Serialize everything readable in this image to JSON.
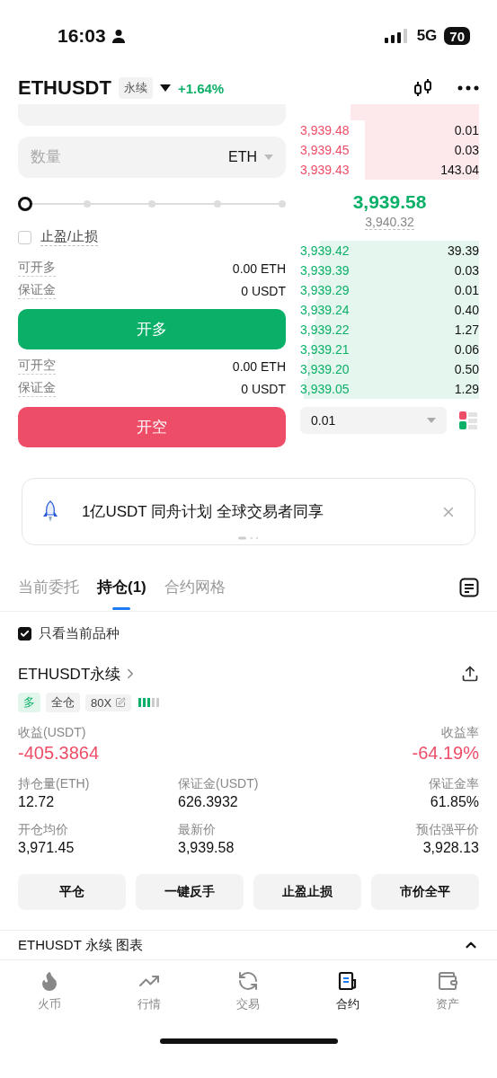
{
  "status_bar": {
    "time": "16:03",
    "network": "5G",
    "battery": "70"
  },
  "header": {
    "symbol": "ETHUSDT",
    "tag": "永续",
    "change": "+1.64%"
  },
  "order_form": {
    "quantity": {
      "placeholder": "数量",
      "unit": "ETH"
    },
    "slider": {
      "level": 0
    },
    "tpsl": {
      "label": "止盈/止损",
      "checked": false
    },
    "long": {
      "rows": [
        {
          "label": "可开多",
          "value": "0.00 ETH"
        },
        {
          "label": "保证金",
          "value": "0 USDT"
        }
      ],
      "button": "开多"
    },
    "short": {
      "rows": [
        {
          "label": "可开空",
          "value": "0.00 ETH"
        },
        {
          "label": "保证金",
          "value": "0 USDT"
        }
      ],
      "button": "开空"
    }
  },
  "order_book": {
    "asks": [
      {
        "price": "3,939.48",
        "amount": "0.01"
      },
      {
        "price": "3,939.45",
        "amount": "0.03"
      },
      {
        "price": "3,939.43",
        "amount": "143.04"
      }
    ],
    "last_price": "3,939.58",
    "mark_price": "3,940.32",
    "bids": [
      {
        "price": "3,939.42",
        "amount": "39.39"
      },
      {
        "price": "3,939.39",
        "amount": "0.03"
      },
      {
        "price": "3,939.29",
        "amount": "0.01"
      },
      {
        "price": "3,939.24",
        "amount": "0.40"
      },
      {
        "price": "3,939.22",
        "amount": "1.27"
      },
      {
        "price": "3,939.21",
        "amount": "0.06"
      },
      {
        "price": "3,939.20",
        "amount": "0.50"
      },
      {
        "price": "3,939.05",
        "amount": "1.29"
      }
    ],
    "precision": "0.01"
  },
  "banner": {
    "text": "1亿USDT 同舟计划 全球交易者同享"
  },
  "tabs": [
    {
      "label": "当前委托",
      "selected": false
    },
    {
      "label": "持仓(1)",
      "selected": true
    },
    {
      "label": "合约网格",
      "selected": false
    }
  ],
  "filter": {
    "label": "只看当前品种",
    "checked": true
  },
  "position": {
    "title": "ETHUSDT永续",
    "tags": [
      {
        "label": "多",
        "kind": "side"
      },
      {
        "label": "全仓",
        "kind": "plain"
      },
      {
        "label": "80X",
        "kind": "leverage"
      }
    ],
    "risk": {
      "level": 0.6
    },
    "pnl": {
      "label": "收益(USDT)",
      "value": "-405.3864"
    },
    "roe": {
      "label": "收益率",
      "value": "-64.19%"
    },
    "stats": [
      {
        "label": "持仓量(ETH)",
        "value": "12.72"
      },
      {
        "label": "保证金(USDT)",
        "value": "626.3932"
      },
      {
        "label": "保证金率",
        "value": "61.85%"
      },
      {
        "label": "开仓均价",
        "value": "3,971.45"
      },
      {
        "label": "最新价",
        "value": "3,939.58"
      },
      {
        "label": "预估强平价",
        "value": "3,928.13"
      }
    ],
    "actions": [
      "平仓",
      "一键反手",
      "止盈止损",
      "市价全平"
    ]
  },
  "chart_bar": {
    "title": "ETHUSDT 永续 图表",
    "expanded": true
  },
  "bottom_nav": [
    {
      "label": "火币",
      "selected": false
    },
    {
      "label": "行情",
      "selected": false
    },
    {
      "label": "交易",
      "selected": false
    },
    {
      "label": "合约",
      "selected": true
    },
    {
      "label": "资产",
      "selected": false
    }
  ]
}
